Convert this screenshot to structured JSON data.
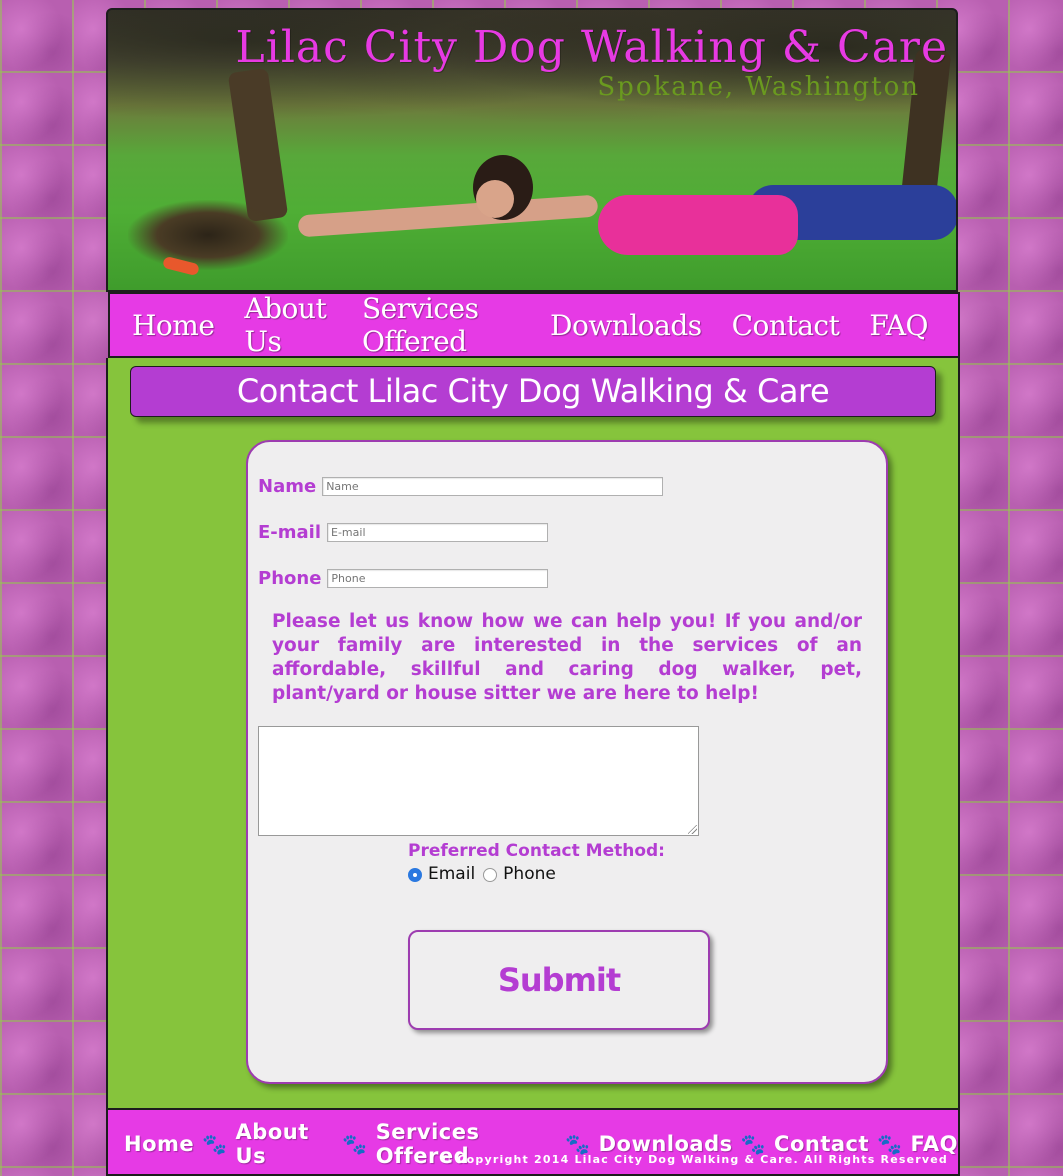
{
  "header": {
    "title": "Lilac City Dog Walking & Care",
    "subtitle": "Spokane, Washington"
  },
  "nav": {
    "items": [
      "Home",
      "About Us",
      "Services Offered",
      "Downloads",
      "Contact",
      "FAQ"
    ]
  },
  "page": {
    "heading": "Contact Lilac City Dog Walking & Care"
  },
  "form": {
    "name_label": "Name",
    "name_placeholder": "Name",
    "email_label": "E-mail",
    "email_placeholder": "E-mail",
    "phone_label": "Phone",
    "phone_placeholder": "Phone",
    "message_text": "Please let us know how we can help you! If you and/or your family are interested in the services of an affordable, skillful and caring dog walker, pet, plant/yard or house sitter we are here to help!",
    "message_value": "",
    "preferred_label": "Preferred Contact Method:",
    "options": [
      "Email",
      "Phone"
    ],
    "selected_option": "Email",
    "submit_label": "Submit"
  },
  "footer": {
    "nav_items": [
      "Home",
      "About Us",
      "Services Offered",
      "Downloads",
      "Contact",
      "FAQ"
    ],
    "copyright": "© Copyright 2014 Lilac City Dog Walking & Care. All Rights Reserved"
  },
  "colors": {
    "accent_magenta": "#e63ae5",
    "heading_purple": "#b43dd2",
    "main_green": "#86c43c",
    "form_bg": "#efeeef",
    "radio_selected": "#2a78e0"
  },
  "icons": {
    "footer_separator": "paw-icon"
  }
}
